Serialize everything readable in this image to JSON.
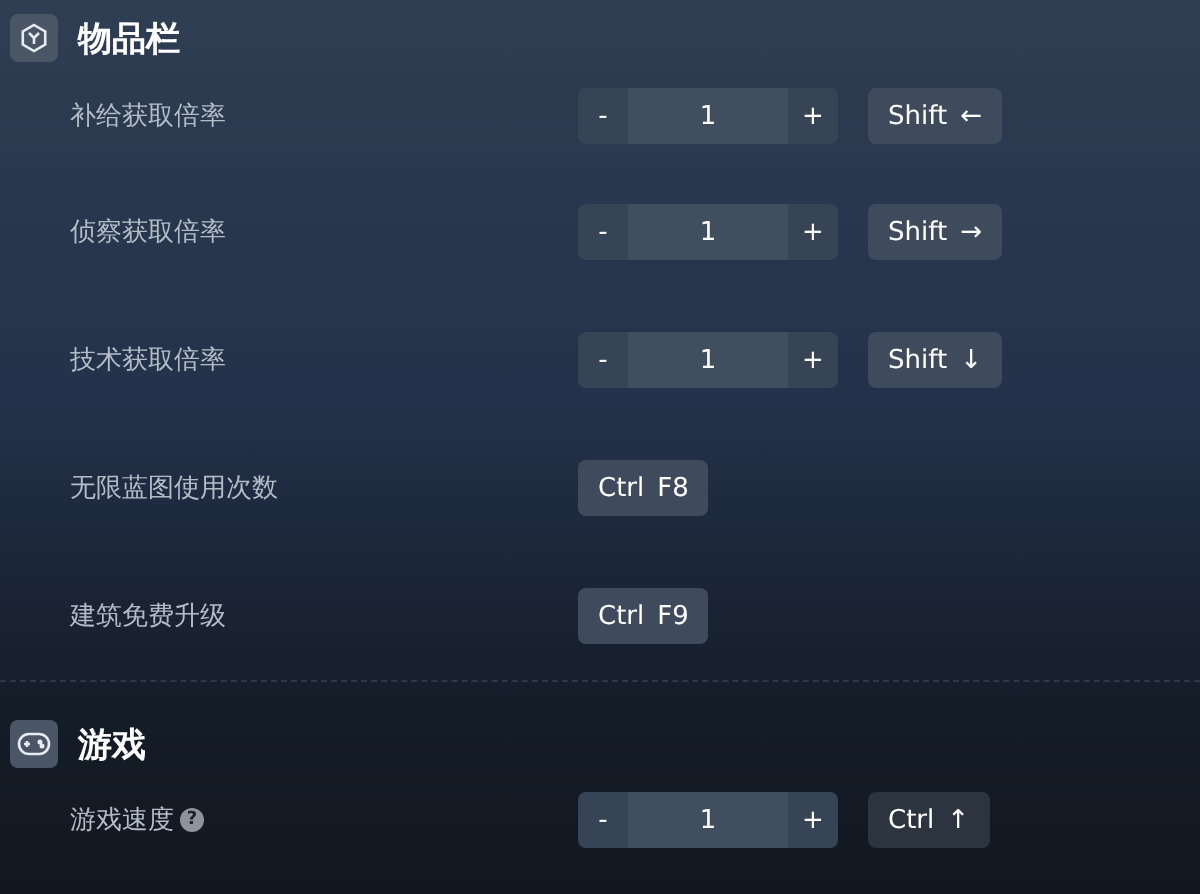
{
  "sections": [
    {
      "title": "物品栏",
      "rows": [
        {
          "label": "补给获取倍率",
          "kind": "stepper",
          "value": "1",
          "decrement": "-",
          "increment": "+",
          "keys": [
            "Shift",
            "←"
          ]
        },
        {
          "label": "侦察获取倍率",
          "kind": "stepper",
          "value": "1",
          "decrement": "-",
          "increment": "+",
          "keys": [
            "Shift",
            "→"
          ]
        },
        {
          "label": "技术获取倍率",
          "kind": "stepper",
          "value": "1",
          "decrement": "-",
          "increment": "+",
          "keys": [
            "Shift",
            "↓"
          ]
        },
        {
          "label": "无限蓝图使用次数",
          "kind": "toggle",
          "keys": [
            "Ctrl",
            "F8"
          ]
        },
        {
          "label": "建筑免费升级",
          "kind": "toggle",
          "keys": [
            "Ctrl",
            "F9"
          ]
        }
      ]
    },
    {
      "title": "游戏",
      "rows": [
        {
          "label": "游戏速度",
          "help": "?",
          "kind": "stepper",
          "value": "1",
          "decrement": "-",
          "increment": "+",
          "keys": [
            "Ctrl",
            "↑"
          ]
        }
      ]
    }
  ]
}
